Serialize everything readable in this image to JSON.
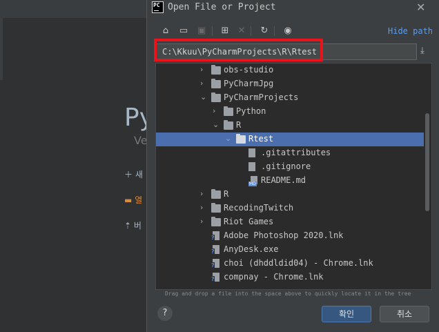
{
  "background": {
    "brand": "Py",
    "version": "Ve",
    "actions": [
      {
        "icon": "plus-icon",
        "label": "새"
      },
      {
        "icon": "folder-open-icon",
        "label": "열"
      },
      {
        "icon": "vcs-checkout-icon",
        "label": "버"
      }
    ]
  },
  "dialog": {
    "title": "Open File or Project",
    "hide_path": "Hide path",
    "path": "C:\\Kkuu\\PyCharmProjects\\R\\Rtest",
    "hint": "Drag and drop a file into the space above to quickly locate it in the tree",
    "ok": "확인",
    "cancel": "취소",
    "help": "?"
  },
  "toolbar": [
    {
      "name": "home-icon",
      "glyph": "⌂"
    },
    {
      "name": "desktop-icon",
      "glyph": "▭"
    },
    {
      "name": "project-folder-icon",
      "glyph": "▣"
    },
    {
      "name": "new-folder-icon",
      "glyph": "⊞"
    },
    {
      "name": "delete-icon",
      "glyph": "✕"
    },
    {
      "name": "refresh-icon",
      "glyph": "↻"
    },
    {
      "name": "show-hidden-icon",
      "glyph": "◉"
    }
  ],
  "tree": [
    {
      "label": "obs-studio",
      "type": "folder",
      "level": 2,
      "arrow": "›"
    },
    {
      "label": "PyCharmJpg",
      "type": "folder",
      "level": 2,
      "arrow": "›"
    },
    {
      "label": "PyCharmProjects",
      "type": "folder",
      "level": 2,
      "arrow": "⌄"
    },
    {
      "label": "Python",
      "type": "folder",
      "level": 3,
      "arrow": "›"
    },
    {
      "label": "R",
      "type": "folder",
      "level": 3,
      "arrow": "⌄"
    },
    {
      "label": "Rtest",
      "type": "folder",
      "level": 4,
      "arrow": "⌄",
      "selected": true
    },
    {
      "label": ".gitattributes",
      "type": "file",
      "level": 5,
      "arrow": ""
    },
    {
      "label": ".gitignore",
      "type": "file",
      "level": 5,
      "arrow": ""
    },
    {
      "label": "README.md",
      "type": "md",
      "level": 5,
      "arrow": ""
    },
    {
      "label": "R",
      "type": "folder",
      "level": 2,
      "arrow": "›"
    },
    {
      "label": "RecodingTwitch",
      "type": "folder",
      "level": 2,
      "arrow": "›"
    },
    {
      "label": "Riot Games",
      "type": "folder",
      "level": 2,
      "arrow": "›"
    },
    {
      "label": "Adobe Photoshop 2020.lnk",
      "type": "lnk",
      "level": 2,
      "arrow": ""
    },
    {
      "label": "AnyDesk.exe",
      "type": "lnk",
      "level": 2,
      "arrow": ""
    },
    {
      "label": "choi (dhddldid04) - Chrome.lnk",
      "type": "lnk",
      "level": 2,
      "arrow": ""
    },
    {
      "label": "compnay - Chrome.lnk",
      "type": "lnk",
      "level": 2,
      "arrow": ""
    }
  ],
  "colors": {
    "selection": "#4b6eaf",
    "highlight_box": "#e8141a",
    "link": "#589df6"
  }
}
